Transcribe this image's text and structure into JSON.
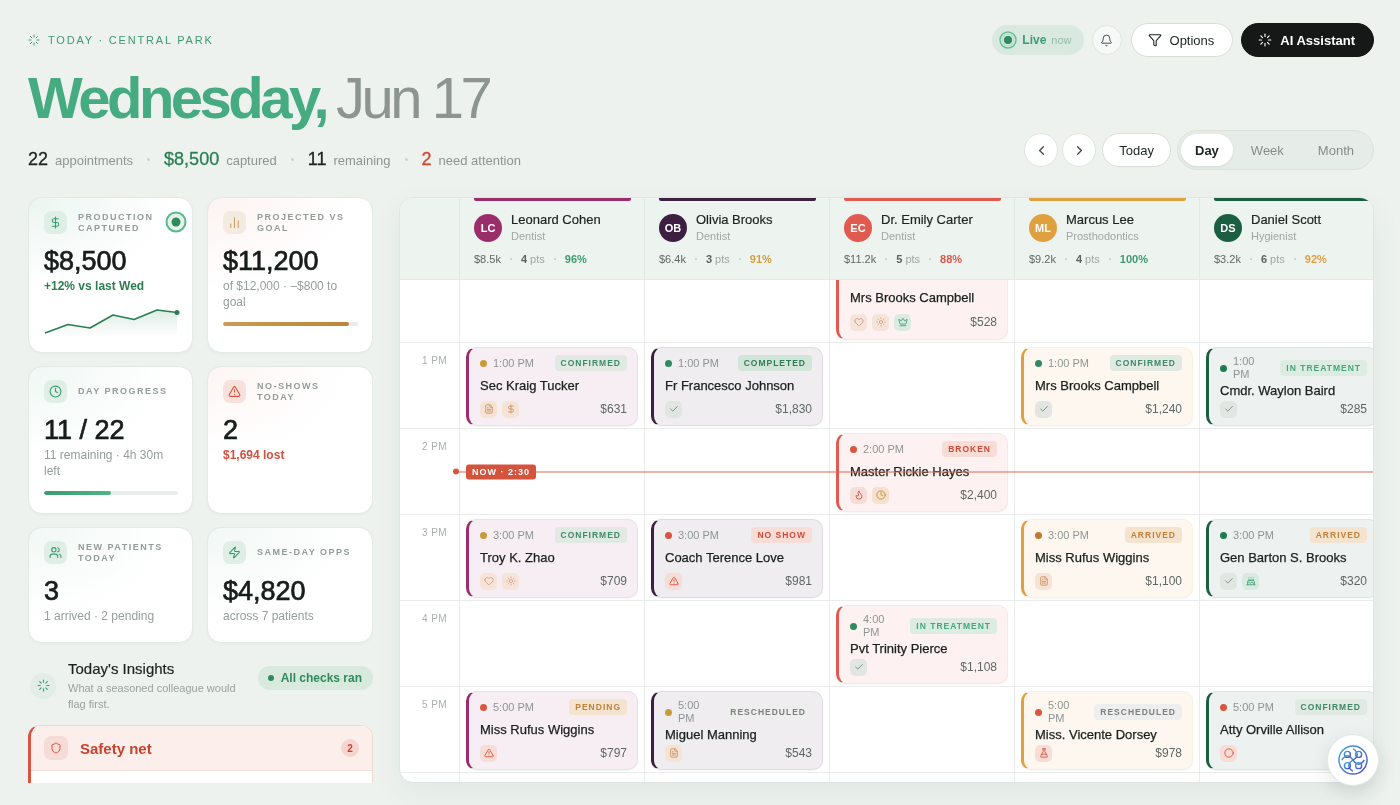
{
  "eyebrow": "TODAY · CENTRAL PARK",
  "title": {
    "weekday": "Wednesday,",
    "date": "Jun 17"
  },
  "summary": [
    {
      "value": "22",
      "label": "appointments",
      "kind": "neutral"
    },
    {
      "value": "$8,500",
      "label": "captured",
      "kind": "positive"
    },
    {
      "value": "11",
      "label": "remaining",
      "kind": "neutral"
    },
    {
      "value": "2",
      "label": "need attention",
      "kind": "alert"
    }
  ],
  "live": {
    "label": "Live",
    "note": "now"
  },
  "actions": {
    "options": "Options",
    "assistant": "AI Assistant"
  },
  "nav": {
    "today": "Today",
    "views": [
      {
        "label": "Day",
        "selected": true
      },
      {
        "label": "Week",
        "selected": false
      },
      {
        "label": "Month",
        "selected": false
      }
    ]
  },
  "kpis": [
    {
      "kind": "production",
      "label": "PRODUCTION CAPTURED",
      "value": "$8,500",
      "note": "+12% vs last Wed"
    },
    {
      "kind": "projection",
      "label": "PROJECTED VS GOAL",
      "value": "$11,200",
      "note": "of $12,000 · –$800 to goal",
      "level": 0.93
    },
    {
      "kind": "progress",
      "label": "DAY PROGRESS",
      "value": "11 / 22",
      "note": "11 remaining · 4h 30m left",
      "level": 0.5
    },
    {
      "kind": "noshows",
      "label": "NO-SHOWS TODAY",
      "value": "2",
      "note": "$1,694 lost"
    },
    {
      "kind": "patients",
      "label": "NEW PATIENTS TODAY",
      "value": "3",
      "note": "1 arrived · 2 pending"
    },
    {
      "kind": "opportunities",
      "label": "SAME-DAY OPPS",
      "value": "$4,820",
      "note": "across 7 patients"
    }
  ],
  "insights": {
    "title": "Today's Insights",
    "subtitle": "What a seasoned colleague would flag first.",
    "badge": "All checks ran"
  },
  "safety_net": {
    "title": "Safety net",
    "count": "2"
  },
  "calendar": {
    "providers": [
      {
        "initials": "LC",
        "name": "Leonard Cohen",
        "role": "Dentist",
        "color": "#9c2d6b",
        "production": "$8.5k",
        "patients": "**4** pts",
        "rate": {
          "value": "96%",
          "color": "#3f9a6e"
        }
      },
      {
        "initials": "OB",
        "name": "Olivia Brooks",
        "role": "Dentist",
        "color": "#3d1f42",
        "production": "$6.4k",
        "patients": "**3** pts",
        "rate": {
          "value": "91%",
          "color": "#d1a03c"
        }
      },
      {
        "initials": "EC",
        "name": "Dr. Emily Carter",
        "role": "Dentist",
        "color": "#e05a4f",
        "production": "$11.2k",
        "patients": "**5** pts",
        "rate": {
          "value": "88%",
          "color": "#e0584e"
        }
      },
      {
        "initials": "ML",
        "name": "Marcus Lee",
        "role": "Prosthodontics",
        "color": "#e0a040",
        "production": "$9.2k",
        "patients": "**4** pts",
        "rate": {
          "value": "100%",
          "color": "#3f9a6e"
        }
      },
      {
        "initials": "DS",
        "name": "Daniel Scott",
        "role": "Hygienist",
        "color": "#1b5e42",
        "production": "$3.2k",
        "patients": "**6** pts",
        "rate": {
          "value": "92%",
          "color": "#e0a040"
        }
      }
    ],
    "rows": [
      {
        "slots": [
          {
            "kind": "empty"
          },
          {
            "kind": "empty"
          },
          {
            "kind": "appointment",
            "name": "Mrs Brooks Campbell",
            "flags": [
              {
                "kind": "heart"
              },
              {
                "kind": "sun"
              },
              {
                "kind": "crown"
              }
            ],
            "amount": "$528"
          },
          {
            "kind": "empty"
          },
          {
            "kind": "empty"
          }
        ]
      },
      {
        "label": "1 PM",
        "slots": [
          {
            "kind": "appointment",
            "color": "#c99a3a",
            "time": "1:00 PM",
            "status": {
              "label": "CONFIRMED",
              "kind": "confirmed"
            },
            "name": "Sec Kraig Tucker",
            "flags": [
              {
                "kind": "document"
              },
              {
                "kind": "dollar"
              }
            ],
            "amount": "$631"
          },
          {
            "kind": "appointment",
            "color": "#2f8a5f",
            "time": "1:00 PM",
            "status": {
              "label": "COMPLETED",
              "kind": "completed"
            },
            "name": "Fr Francesco Johnson",
            "flags": [
              {
                "kind": "check"
              }
            ],
            "amount": "$1,830"
          },
          {
            "kind": "empty"
          },
          {
            "kind": "appointment",
            "color": "#2f8a5f",
            "time": "1:00 PM",
            "status": {
              "label": "CONFIRMED",
              "kind": "confirmed"
            },
            "name": "Mrs Brooks Campbell",
            "flags": [
              {
                "kind": "check"
              }
            ],
            "amount": "$1,240"
          },
          {
            "kind": "appointment",
            "color": "#1f7a50",
            "time": "1:00 PM",
            "status": {
              "label": "IN TREATMENT",
              "kind": "active"
            },
            "name": "Cmdr. Waylon Baird",
            "flags": [
              {
                "kind": "check"
              }
            ],
            "amount": "$285"
          }
        ]
      },
      {
        "label": "2 PM",
        "now": "NOW · 2:30",
        "slots": [
          {
            "kind": "empty"
          },
          {
            "kind": "empty"
          },
          {
            "kind": "appointment",
            "color": "#d9553f",
            "time": "2:00 PM",
            "status": {
              "label": "BROKEN",
              "kind": "danger"
            },
            "name": "Master Rickie Hayes",
            "flags": [
              {
                "kind": "flame"
              },
              {
                "kind": "clock"
              }
            ],
            "amount": "$2,400"
          },
          {
            "kind": "empty"
          },
          {
            "kind": "empty"
          }
        ]
      },
      {
        "label": "3 PM",
        "slots": [
          {
            "kind": "appointment",
            "color": "#c99a3a",
            "time": "3:00 PM",
            "status": {
              "label": "CONFIRMED",
              "kind": "confirmed"
            },
            "name": "Troy K. Zhao",
            "flags": [
              {
                "kind": "heart"
              },
              {
                "kind": "sun"
              }
            ],
            "amount": "$709"
          },
          {
            "kind": "appointment",
            "color": "#d9553f",
            "time": "3:00 PM",
            "status": {
              "label": "NO SHOW",
              "kind": "danger"
            },
            "name": "Coach Terence Love",
            "flags": [
              {
                "kind": "alert"
              }
            ],
            "amount": "$981"
          },
          {
            "kind": "empty"
          },
          {
            "kind": "appointment",
            "color": "#c07a35",
            "time": "3:00 PM",
            "status": {
              "label": "ARRIVED",
              "kind": "warning"
            },
            "name": "Miss Rufus Wiggins",
            "flags": [
              {
                "kind": "document"
              }
            ],
            "amount": "$1,100"
          },
          {
            "kind": "appointment",
            "color": "#1f7a50",
            "time": "3:00 PM",
            "status": {
              "label": "ARRIVED",
              "kind": "warning"
            },
            "name": "Gen Barton S. Brooks",
            "flags": [
              {
                "kind": "check"
              },
              {
                "kind": "cake"
              }
            ],
            "amount": "$320"
          }
        ]
      },
      {
        "label": "4 PM",
        "slots": [
          {
            "kind": "empty"
          },
          {
            "kind": "empty"
          },
          {
            "kind": "appointment",
            "color": "#2f8a5f",
            "time": "4:00 PM",
            "status": {
              "label": "IN TREATMENT",
              "kind": "active"
            },
            "name": "Pvt Trinity Pierce",
            "flags": [
              {
                "kind": "check"
              }
            ],
            "amount": "$1,108"
          },
          {
            "kind": "empty"
          },
          {
            "kind": "empty"
          }
        ]
      },
      {
        "label": "5 PM",
        "slots": [
          {
            "kind": "appointment",
            "color": "#d9553f",
            "time": "5:00 PM",
            "status": {
              "label": "PENDING",
              "kind": "warning"
            },
            "name": "Miss Rufus Wiggins",
            "flags": [
              {
                "kind": "alert"
              }
            ],
            "amount": "$797"
          },
          {
            "kind": "appointment",
            "color": "#c99a3a",
            "time": "5:00 PM",
            "status": {
              "label": "RESCHEDULED",
              "kind": "neutral"
            },
            "name": "Miguel Manning",
            "flags": [
              {
                "kind": "document"
              }
            ],
            "amount": "$543"
          },
          {
            "kind": "empty"
          },
          {
            "kind": "appointment",
            "color": "#d9553f",
            "time": "5:00 PM",
            "status": {
              "label": "RESCHEDULED",
              "kind": "neutral"
            },
            "name": "Miss. Vicente Dorsey",
            "flags": [
              {
                "kind": "flask"
              }
            ],
            "amount": "$978"
          },
          {
            "kind": "appointment",
            "color": "#d9553f",
            "time": "5:00 PM",
            "status": {
              "label": "CONFIRMED",
              "kind": "confirmed"
            },
            "name": "Atty Orville Allison",
            "flags": [
              {
                "kind": "ring"
              }
            ]
          }
        ]
      }
    ]
  }
}
